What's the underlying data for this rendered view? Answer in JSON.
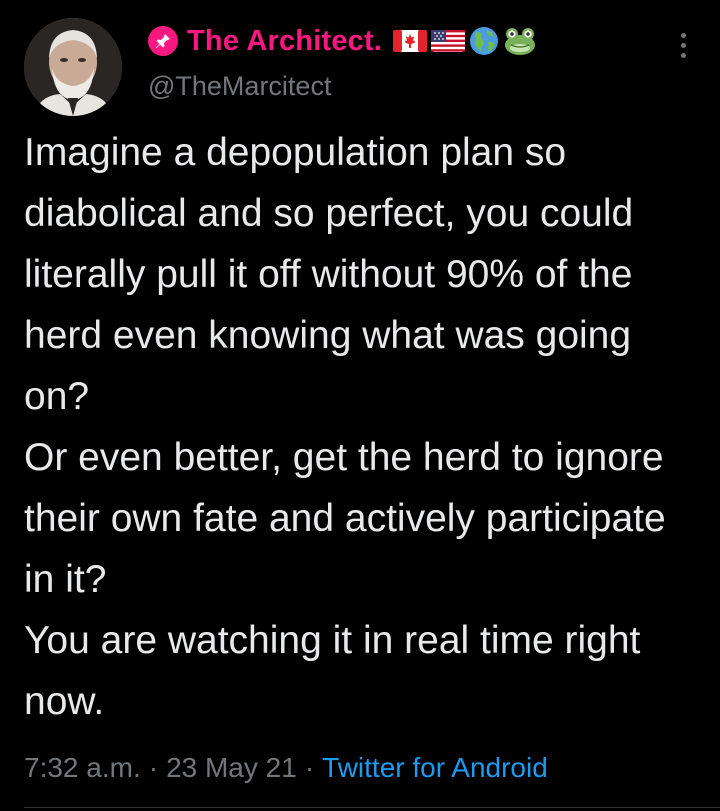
{
  "tweet": {
    "display_name": "The Architect.",
    "handle": "@TheMarcitect",
    "text": "Imagine a depopulation plan so diabolical and so perfect, you could literally pull it off without 90% of the herd even knowing what was going on?\nOr even better, get the herd to ignore their own fate and actively participate in it?\nYou are watching it in real time right now.",
    "time": "7:32 a.m.",
    "date": "23 May 21",
    "separator": "·",
    "source": "Twitter for Android",
    "name_emojis": [
      "canada-flag-icon",
      "usa-flag-icon",
      "globe-americas-icon",
      "frog-icon"
    ],
    "badge_icon": "pin-icon"
  },
  "colors": {
    "background": "#000000",
    "name": "#f91880",
    "text": "#e7e9ea",
    "muted": "#71767b",
    "link": "#1d9bf0"
  }
}
